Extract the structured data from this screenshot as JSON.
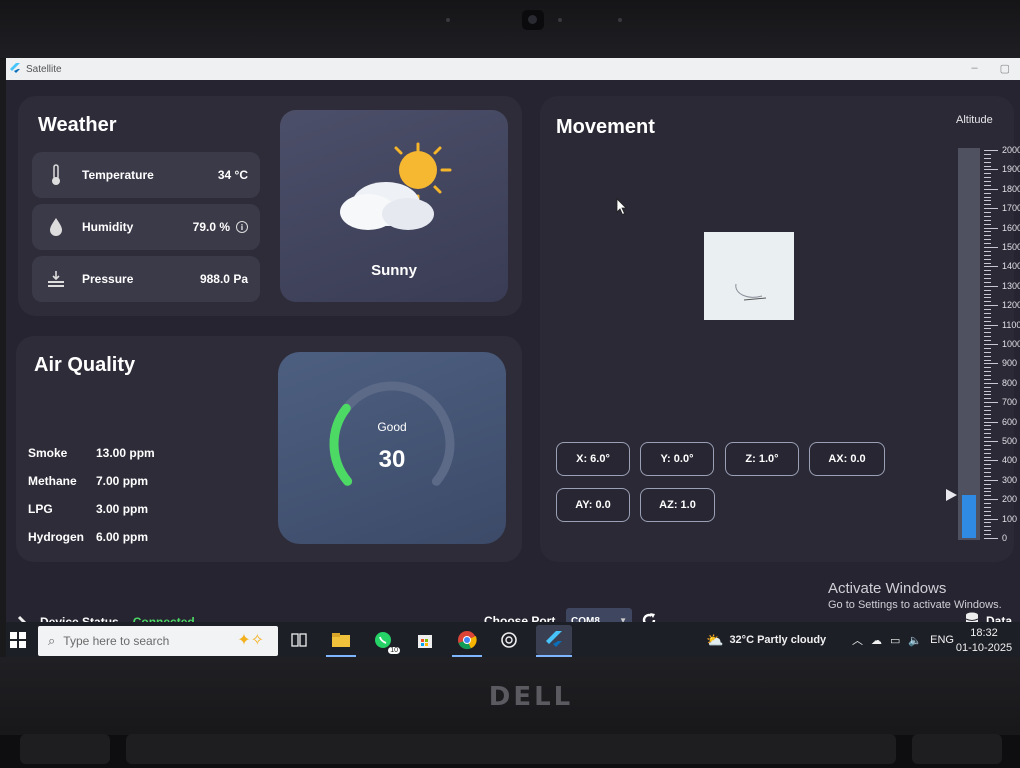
{
  "window": {
    "title": "Satellite"
  },
  "weather": {
    "title": "Weather",
    "rows": [
      {
        "label": "Temperature",
        "value": "34 °C",
        "icon": "thermometer-icon"
      },
      {
        "label": "Humidity",
        "value": "79.0 %",
        "icon": "droplet-icon",
        "info_icon": "info-icon"
      },
      {
        "label": "Pressure",
        "value": "988.0 Pa",
        "icon": "pressure-icon"
      }
    ],
    "condition": "Sunny",
    "condition_icon": "sun-cloud-icon"
  },
  "air_quality": {
    "title": "Air Quality",
    "rows": [
      {
        "label": "Smoke",
        "value": "13.00 ppm"
      },
      {
        "label": "Methane",
        "value": "7.00 ppm"
      },
      {
        "label": "LPG",
        "value": "3.00 ppm"
      },
      {
        "label": "Hydrogen",
        "value": "6.00 ppm"
      }
    ],
    "gauge": {
      "status": "Good",
      "value": "30",
      "fill_fraction": 0.3
    }
  },
  "movement": {
    "title": "Movement",
    "buttons": [
      "X: 6.0°",
      "Y: 0.0°",
      "Z: 1.0°",
      "AX: 0.0",
      "AY: 0.0",
      "AZ: 1.0"
    ]
  },
  "altitude": {
    "title": "Altitude",
    "ticks": [
      "2000",
      "1900",
      "1800",
      "1700",
      "1600",
      "1500",
      "1400",
      "1300",
      "1200",
      "1100",
      "1000",
      "900",
      "800",
      "700",
      "600",
      "500",
      "400",
      "300",
      "200",
      "100",
      "0"
    ],
    "value": 220,
    "max": 2000,
    "fill_color": "#2f8ae3"
  },
  "status": {
    "device_label": "Device Status",
    "device_value": "Connected",
    "device_value_color": "#4cd964",
    "port_label": "Choose Port",
    "port_value": "COM8",
    "data_label": "Data"
  },
  "watermark": {
    "line1": "Activate Windows",
    "line2": "Go to Settings to activate Windows."
  },
  "taskbar": {
    "search_placeholder": "Type here to search",
    "whatsapp_badge": "10",
    "weather": "32°C  Partly cloudy",
    "language": "ENG",
    "time": "18:32",
    "date": "01-10-2025"
  },
  "bezel": {
    "brand": "DELL"
  }
}
